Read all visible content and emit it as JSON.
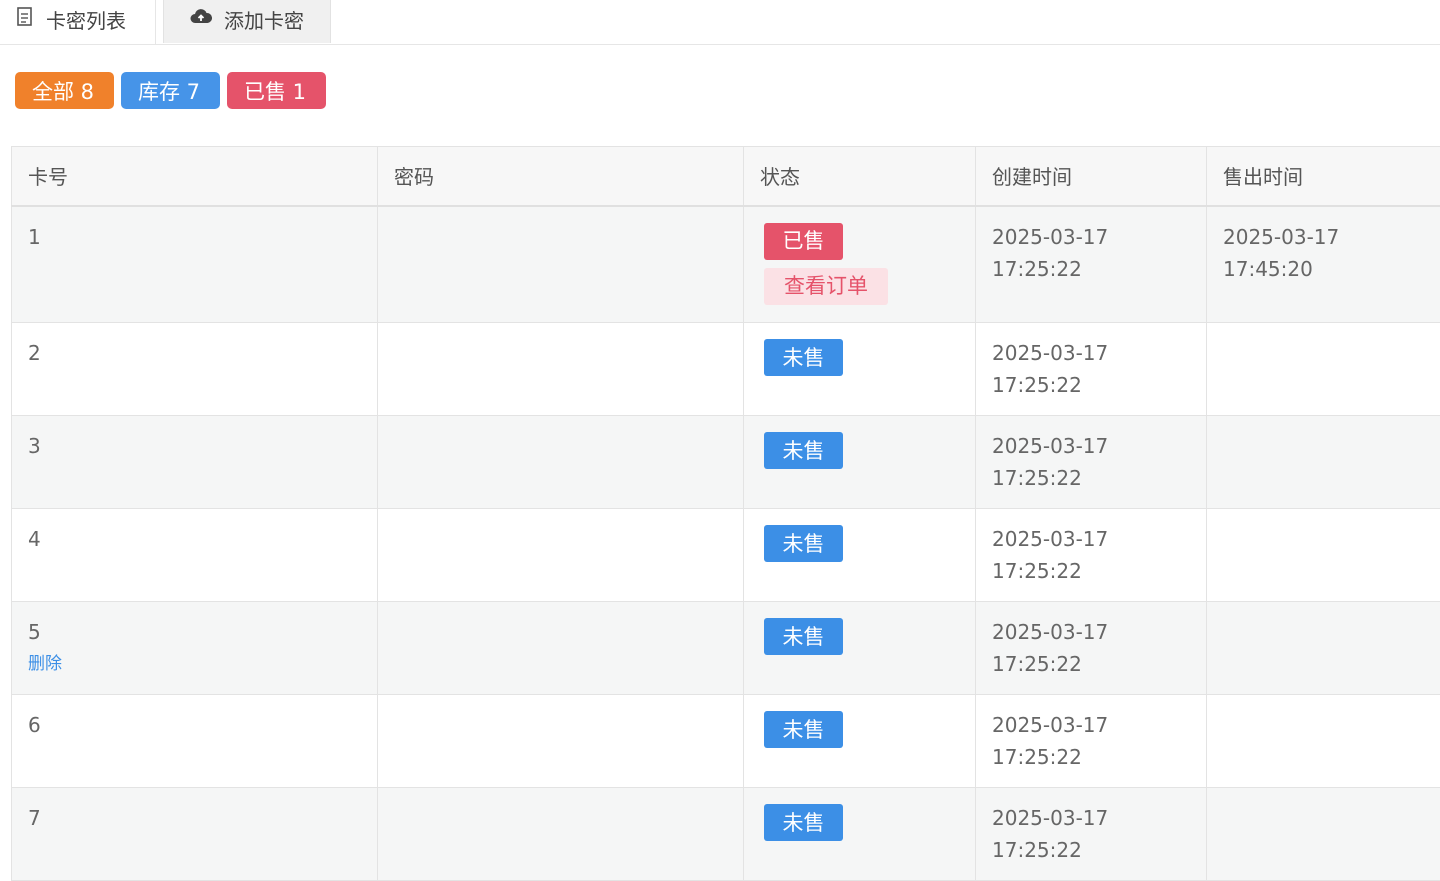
{
  "tabs": [
    {
      "label": "卡密列表",
      "icon": "document-icon",
      "active": true
    },
    {
      "label": "添加卡密",
      "icon": "cloud-upload-icon",
      "active": false
    }
  ],
  "filters": [
    {
      "label": "全部 8",
      "color": "#f0812b"
    },
    {
      "label": "库存 7",
      "color": "#4694e8"
    },
    {
      "label": "已售 1",
      "color": "#e5536a"
    }
  ],
  "table": {
    "headers": [
      "卡号",
      "密码",
      "状态",
      "创建时间",
      "售出时间"
    ],
    "rows": [
      {
        "no": "1",
        "password": "",
        "status": "已售",
        "view_order": "查看订单",
        "created_date": "2025-03-17",
        "created_time": "17:25:22",
        "sold_date": "2025-03-17",
        "sold_time": "17:45:20"
      },
      {
        "no": "2",
        "password": "",
        "status": "未售",
        "created_date": "2025-03-17",
        "created_time": "17:25:22",
        "sold_date": "",
        "sold_time": ""
      },
      {
        "no": "3",
        "password": "",
        "status": "未售",
        "created_date": "2025-03-17",
        "created_time": "17:25:22",
        "sold_date": "",
        "sold_time": ""
      },
      {
        "no": "4",
        "password": "",
        "status": "未售",
        "created_date": "2025-03-17",
        "created_time": "17:25:22",
        "sold_date": "",
        "sold_time": ""
      },
      {
        "no": "5",
        "delete_label": "删除",
        "password": "",
        "status": "未售",
        "created_date": "2025-03-17",
        "created_time": "17:25:22",
        "sold_date": "",
        "sold_time": ""
      },
      {
        "no": "6",
        "password": "",
        "status": "未售",
        "created_date": "2025-03-17",
        "created_time": "17:25:22",
        "sold_date": "",
        "sold_time": ""
      },
      {
        "no": "7",
        "password": "",
        "status": "未售",
        "created_date": "2025-03-17",
        "created_time": "17:25:22",
        "sold_date": "",
        "sold_time": ""
      }
    ]
  },
  "colors": {
    "sold": "#e5536a",
    "unsold": "#3c8fe6",
    "all": "#f0812b"
  }
}
